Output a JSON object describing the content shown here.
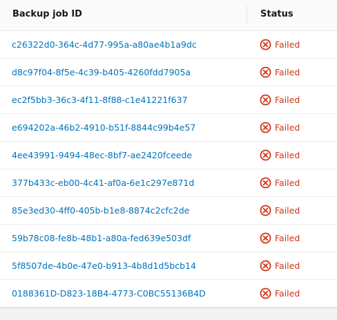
{
  "table": {
    "columns": {
      "id": "Backup job ID",
      "status": "Status"
    },
    "rows": [
      {
        "id": "c26322d0-364c-4d77-995a-a80ae4b1a9dc",
        "status": "Failed"
      },
      {
        "id": "d8c97f04-8f5e-4c39-b405-4260fdd7905a",
        "status": "Failed"
      },
      {
        "id": "ec2f5bb3-36c3-4f11-8f88-c1e41221f637",
        "status": "Failed"
      },
      {
        "id": "e694202a-46b2-4910-b51f-8844c99b4e57",
        "status": "Failed"
      },
      {
        "id": "4ee43991-9494-48ec-8bf7-ae2420fceede",
        "status": "Failed"
      },
      {
        "id": "377b433c-eb00-4c41-af0a-6e1c297e871d",
        "status": "Failed"
      },
      {
        "id": "85e3ed30-4ff0-405b-b1e8-8874c2cfc2de",
        "status": "Failed"
      },
      {
        "id": "59b78c08-fe8b-48b1-a80a-fed639e503df",
        "status": "Failed"
      },
      {
        "id": "5f8507de-4b0e-47e0-b913-4b8d1d5bcb14",
        "status": "Failed"
      },
      {
        "id": "0188361D-D823-18B4-4773-C0BC55136B4D",
        "status": "Failed"
      }
    ],
    "status_icon": "error-circle-x-icon",
    "colors": {
      "link": "#0073bb",
      "error": "#d13212"
    }
  }
}
